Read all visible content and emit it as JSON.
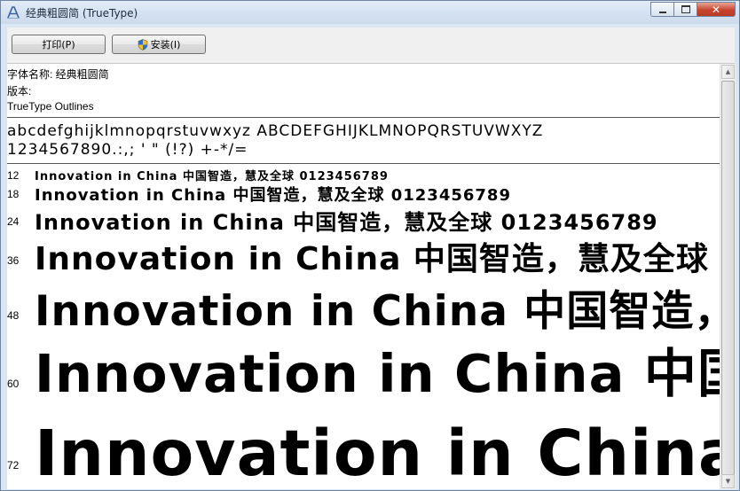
{
  "window": {
    "title": "经典粗圆简 (TrueType)"
  },
  "caption_buttons": {
    "minimize": "▭",
    "maximize": "□",
    "close": "✕"
  },
  "toolbar": {
    "print_label": "打印(P)",
    "install_label": "安装(I)"
  },
  "info": {
    "font_name": "字体名称: 经典粗圆简",
    "version": "版本:",
    "outline_type": "TrueType Outlines"
  },
  "charset": {
    "letters": "abcdefghijklmnopqrstuvwxyz ABCDEFGHIJKLMNOPQRSTUVWXYZ",
    "digits_punct": "1234567890.:,; ' \" (!?) +-*/="
  },
  "sample_text": "Innovation in China 中国智造，慧及全球 0123456789",
  "sizes": [
    {
      "label": "12"
    },
    {
      "label": "18"
    },
    {
      "label": "24"
    },
    {
      "label": "36"
    },
    {
      "label": "48"
    },
    {
      "label": "60"
    },
    {
      "label": "72"
    }
  ]
}
